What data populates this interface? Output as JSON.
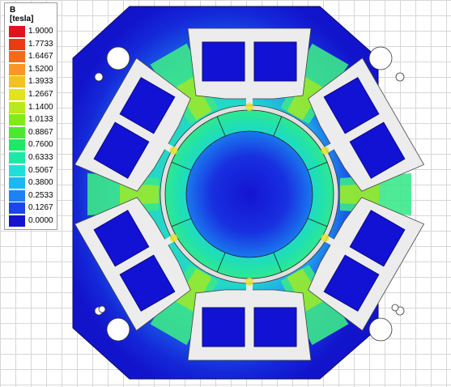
{
  "legend": {
    "title": "B",
    "unit": "[tesla]",
    "entries": [
      {
        "value": "1.9000",
        "color": "#e0141c"
      },
      {
        "value": "1.7733",
        "color": "#ee3a14"
      },
      {
        "value": "1.6467",
        "color": "#f56a1a"
      },
      {
        "value": "1.5200",
        "color": "#f8962a"
      },
      {
        "value": "1.3933",
        "color": "#f4c21c"
      },
      {
        "value": "1.2667",
        "color": "#e2e41a"
      },
      {
        "value": "1.1400",
        "color": "#b8ea1a"
      },
      {
        "value": "1.0133",
        "color": "#84e81e"
      },
      {
        "value": "0.8867",
        "color": "#4ae82e"
      },
      {
        "value": "0.7600",
        "color": "#1ee86a"
      },
      {
        "value": "0.6333",
        "color": "#1ee8a8"
      },
      {
        "value": "0.5067",
        "color": "#1ee0d8"
      },
      {
        "value": "0.3800",
        "color": "#1eb8f0"
      },
      {
        "value": "0.2533",
        "color": "#1e82f0"
      },
      {
        "value": "0.1267",
        "color": "#1a48e8"
      },
      {
        "value": "0.0000",
        "color": "#1414d0"
      }
    ]
  },
  "model": {
    "stator_slots": 12,
    "rotor_segments": 8,
    "colors": {
      "stator_low": "#1222d6",
      "stator_mid": "#1a8cf0",
      "tooth": "#3ce88a",
      "tooth_high": "#9ee82a",
      "hot": "#e8e424",
      "slot": "#ececec",
      "coil": "#1212d4",
      "coil_edge": "#0a0a80",
      "airgap": "#e8e8e8"
    }
  }
}
